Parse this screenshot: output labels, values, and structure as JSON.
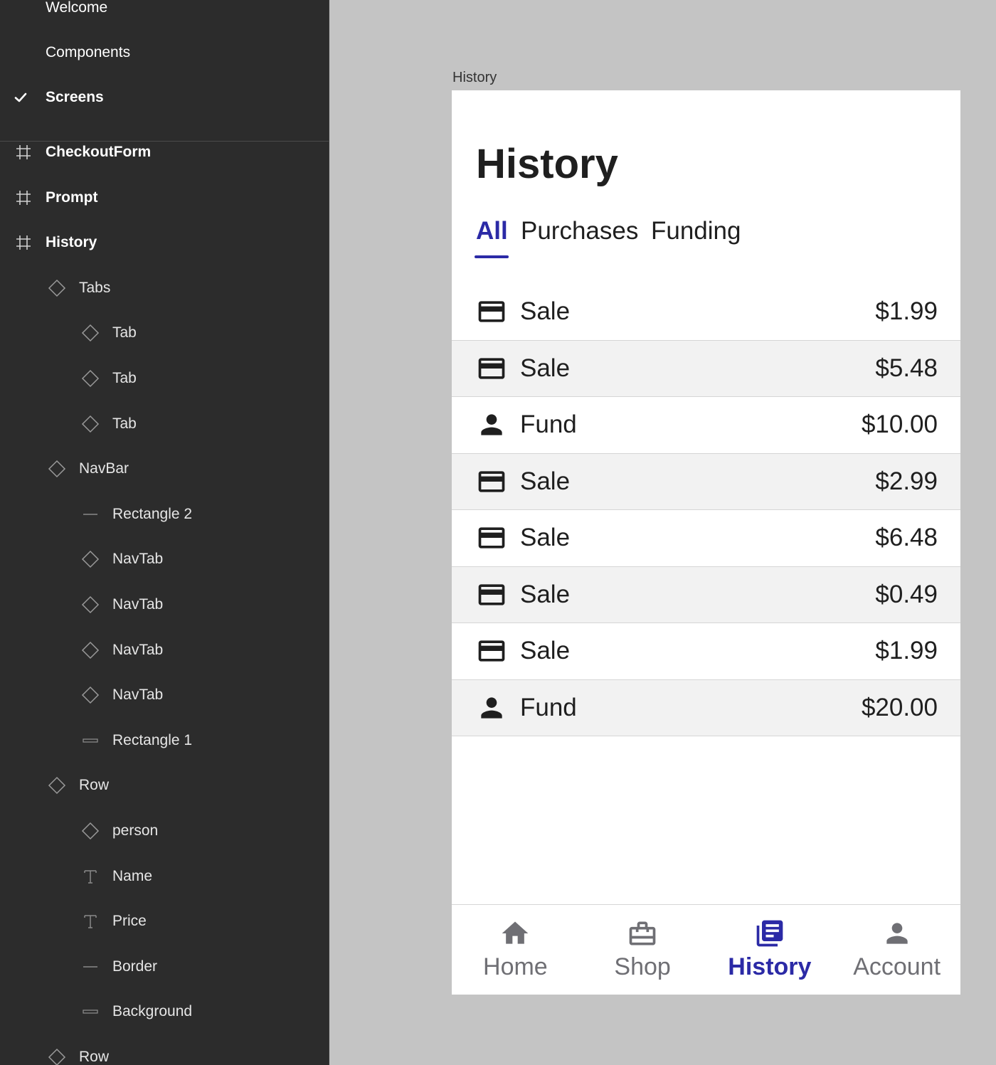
{
  "layers_panel": {
    "pages": [
      {
        "label": "Welcome",
        "current": false
      },
      {
        "label": "Components",
        "current": false
      },
      {
        "label": "Screens",
        "current": true
      }
    ],
    "layers": [
      {
        "label": "CheckoutForm",
        "type": "frame",
        "depth": 0
      },
      {
        "label": "Prompt",
        "type": "frame",
        "depth": 0
      },
      {
        "label": "History",
        "type": "frame",
        "depth": 0
      },
      {
        "label": "Tabs",
        "type": "instance",
        "depth": 1
      },
      {
        "label": "Tab",
        "type": "instance",
        "depth": 2
      },
      {
        "label": "Tab",
        "type": "instance",
        "depth": 2
      },
      {
        "label": "Tab",
        "type": "instance",
        "depth": 2
      },
      {
        "label": "NavBar",
        "type": "instance",
        "depth": 1
      },
      {
        "label": "Rectangle 2",
        "type": "line",
        "depth": 2
      },
      {
        "label": "NavTab",
        "type": "instance",
        "depth": 2
      },
      {
        "label": "NavTab",
        "type": "instance",
        "depth": 2
      },
      {
        "label": "NavTab",
        "type": "instance",
        "depth": 2
      },
      {
        "label": "NavTab",
        "type": "instance",
        "depth": 2
      },
      {
        "label": "Rectangle 1",
        "type": "rect",
        "depth": 2
      },
      {
        "label": "Row",
        "type": "instance",
        "depth": 1
      },
      {
        "label": "person",
        "type": "instance",
        "depth": 2
      },
      {
        "label": "Name",
        "type": "text",
        "depth": 2
      },
      {
        "label": "Price",
        "type": "text",
        "depth": 2
      },
      {
        "label": "Border",
        "type": "line",
        "depth": 2
      },
      {
        "label": "Background",
        "type": "rect",
        "depth": 2
      },
      {
        "label": "Row",
        "type": "instance",
        "depth": 1
      }
    ]
  },
  "canvas": {
    "frame_label": "History"
  },
  "screen": {
    "title": "History",
    "tabs": [
      {
        "label": "All",
        "active": true
      },
      {
        "label": "Purchases",
        "active": false
      },
      {
        "label": "Funding",
        "active": false
      }
    ],
    "rows": [
      {
        "icon": "credit-card-icon",
        "name": "Sale",
        "price": "$1.99"
      },
      {
        "icon": "credit-card-icon",
        "name": "Sale",
        "price": "$5.48"
      },
      {
        "icon": "person-icon",
        "name": "Fund",
        "price": "$10.00"
      },
      {
        "icon": "credit-card-icon",
        "name": "Sale",
        "price": "$2.99"
      },
      {
        "icon": "credit-card-icon",
        "name": "Sale",
        "price": "$6.48"
      },
      {
        "icon": "credit-card-icon",
        "name": "Sale",
        "price": "$0.49"
      },
      {
        "icon": "credit-card-icon",
        "name": "Sale",
        "price": "$1.99"
      },
      {
        "icon": "person-icon",
        "name": "Fund",
        "price": "$20.00"
      }
    ],
    "navbar": [
      {
        "icon": "home-icon",
        "label": "Home",
        "active": false
      },
      {
        "icon": "briefcase-icon",
        "label": "Shop",
        "active": false
      },
      {
        "icon": "history-icon",
        "label": "History",
        "active": true
      },
      {
        "icon": "account-icon",
        "label": "Account",
        "active": false
      }
    ]
  },
  "colors": {
    "accent": "#2b2aa6",
    "panel_bg": "#2c2c2c",
    "canvas_bg": "#c4c4c4",
    "row_alt_bg": "#f2f2f2",
    "nav_inactive": "#6f6f74"
  }
}
